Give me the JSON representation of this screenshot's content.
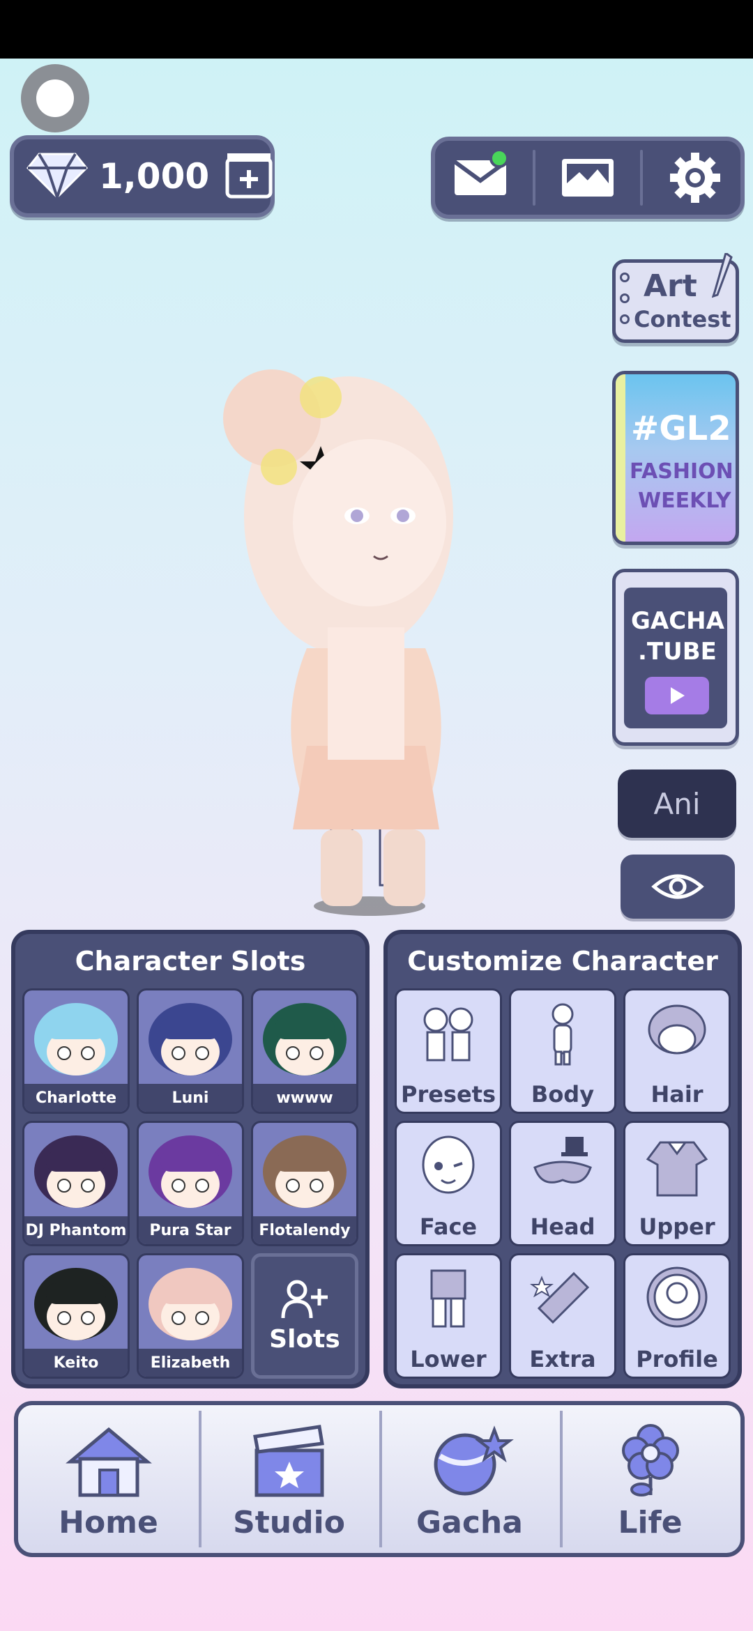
{
  "header": {
    "gem_count": "1,000"
  },
  "side": {
    "art_contest": {
      "line1": "Art",
      "line2": "Contest"
    },
    "fashion_weekly": {
      "hashtag": "#GL2",
      "line1": "FASHION",
      "line2": "WEEKLY"
    },
    "gacha_tube": {
      "line1": "GACHA",
      "line2": ".TUBE"
    },
    "ani_label": "Ani"
  },
  "character_slots": {
    "title": "Character Slots",
    "slots": [
      {
        "name": "Charlotte",
        "hair": "#8fd4ee"
      },
      {
        "name": "Luni",
        "hair": "#3b4690"
      },
      {
        "name": "wwww",
        "hair": "#1f5a4a"
      },
      {
        "name": "DJ Phantom",
        "hair": "#3a2a55"
      },
      {
        "name": "Pura Star",
        "hair": "#6b3aa0"
      },
      {
        "name": "Flotalendy",
        "hair": "#8a6a55"
      },
      {
        "name": "Keito",
        "hair": "#1e2322"
      },
      {
        "name": "Elizabeth",
        "hair": "#f0c8c0"
      }
    ],
    "add_label": "Slots"
  },
  "customize": {
    "title": "Customize Character",
    "items": [
      "Presets",
      "Body",
      "Hair",
      "Face",
      "Head",
      "Upper",
      "Lower",
      "Extra",
      "Profile"
    ]
  },
  "nav": {
    "items": [
      "Home",
      "Studio",
      "Gacha",
      "Life"
    ]
  },
  "colors": {
    "panel": "#4a5077",
    "panel_border": "#353a5e",
    "tile": "#d8dbf8",
    "accent": "#a57ce6",
    "notification": "#49d65a"
  }
}
